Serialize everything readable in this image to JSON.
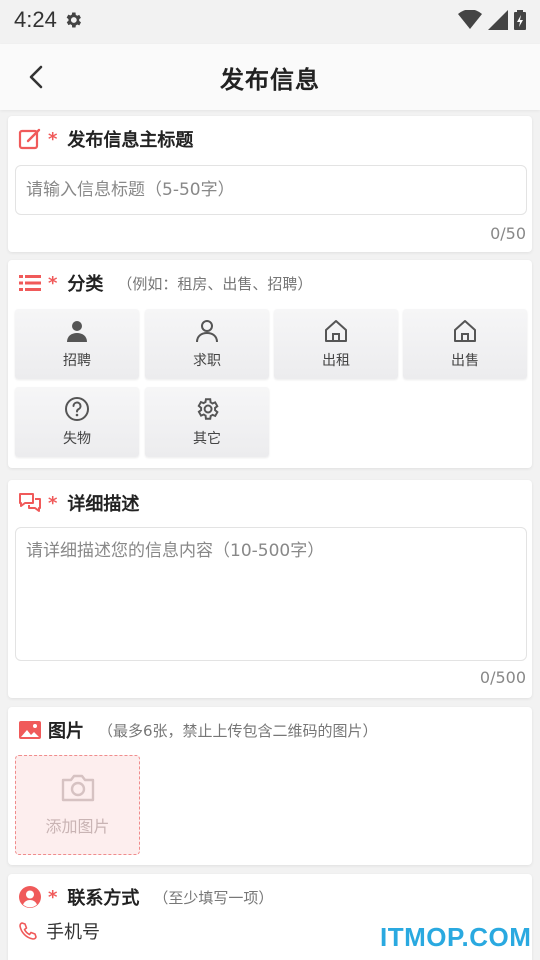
{
  "status": {
    "time": "4:24"
  },
  "appbar": {
    "title": "发布信息"
  },
  "title_section": {
    "label": "发布信息主标题",
    "placeholder": "请输入信息标题（5-50字）",
    "counter": "0/50"
  },
  "category_section": {
    "label": "分类",
    "hint": "（例如：租房、出售、招聘）",
    "items": [
      {
        "label": "招聘",
        "icon": "person-filled-icon"
      },
      {
        "label": "求职",
        "icon": "person-outline-icon"
      },
      {
        "label": "出租",
        "icon": "house-icon"
      },
      {
        "label": "出售",
        "icon": "house-icon"
      },
      {
        "label": "失物",
        "icon": "question-circle-icon"
      },
      {
        "label": "其它",
        "icon": "gear-icon"
      }
    ]
  },
  "description_section": {
    "label": "详细描述",
    "placeholder": "请详细描述您的信息内容（10-500字）",
    "counter": "0/500"
  },
  "image_section": {
    "label": "图片",
    "hint": "（最多6张，禁止上传包含二维码的图片）",
    "add_label": "添加图片"
  },
  "contact_section": {
    "label": "联系方式",
    "hint": "（至少填写一项）",
    "phone_label": "手机号"
  },
  "watermark": "ITMOP.COM",
  "colors": {
    "accent": "#f05a5a",
    "watermark": "#2aa9e0"
  }
}
